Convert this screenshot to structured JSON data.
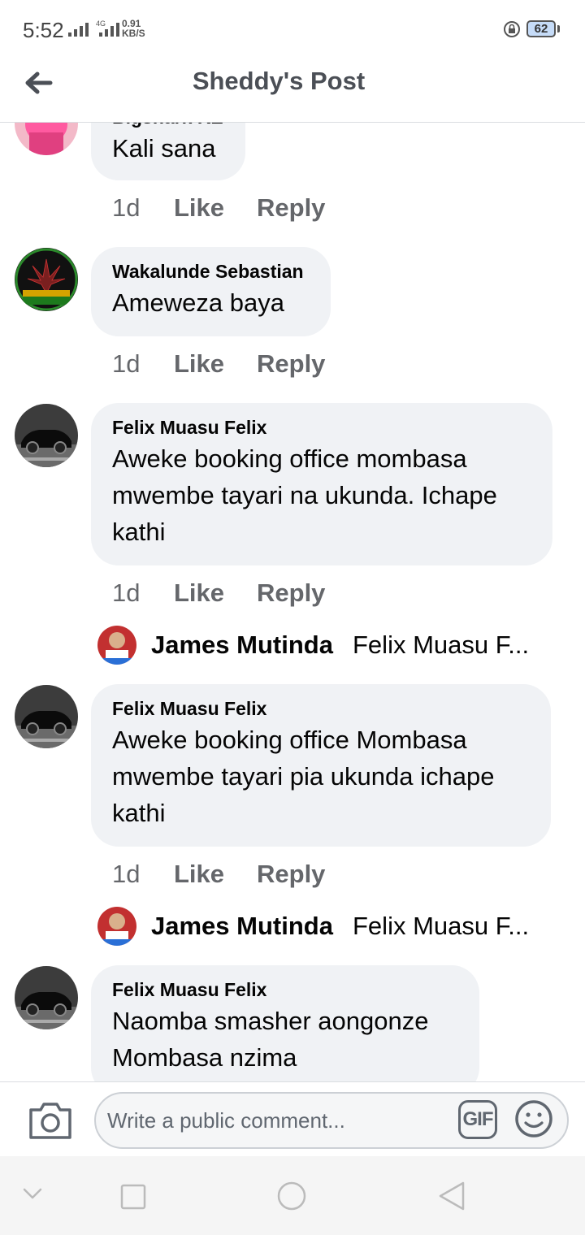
{
  "status_bar": {
    "time": "5:52",
    "network_type": "4G",
    "speed_value": "0.91",
    "speed_unit": "KB/S",
    "battery": "62"
  },
  "header": {
    "title": "Sheddy's Post"
  },
  "comments": [
    {
      "author": "Bigshark KE",
      "text": "Kali sana",
      "time": "1d",
      "like": "Like",
      "reply": "Reply",
      "avatar_icon": "person-photo"
    },
    {
      "author": "Wakalunde Sebastian",
      "text": "Ameweza baya",
      "time": "1d",
      "like": "Like",
      "reply": "Reply",
      "avatar_icon": "leaf-emblem"
    },
    {
      "author": "Felix Muasu Felix",
      "text": "Aweke booking office mombasa mwembe tayari na ukunda. Ichape kathi",
      "time": "1d",
      "like": "Like",
      "reply": "Reply",
      "avatar_icon": "car-photo",
      "reply_preview": {
        "name": "James Mutinda",
        "snippet": "Felix Muasu F..."
      }
    },
    {
      "author": "Felix Muasu Felix",
      "text": "Aweke booking office Mombasa mwembe tayari pia ukunda ichape kathi",
      "time": "1d",
      "like": "Like",
      "reply": "Reply",
      "avatar_icon": "car-photo",
      "reply_preview": {
        "name": "James Mutinda",
        "snippet": "Felix Muasu F..."
      }
    },
    {
      "author": "Felix Muasu Felix",
      "text": "Naomba smasher aongonze Mombasa nzima",
      "avatar_icon": "car-photo"
    }
  ],
  "composer": {
    "placeholder": "Write a public comment...",
    "gif_label": "GIF"
  },
  "colors": {
    "bubble": "#f0f2f5",
    "secondary_text": "#65676b",
    "title": "#4b4f56"
  }
}
